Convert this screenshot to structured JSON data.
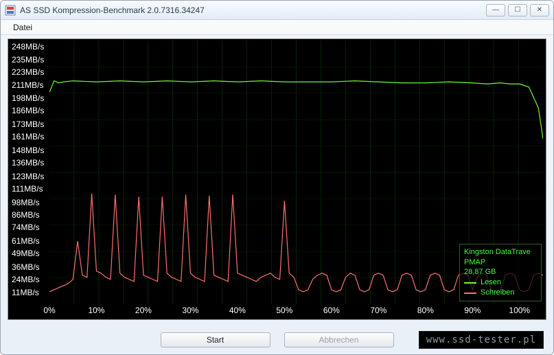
{
  "window": {
    "title": "AS SSD Kompression-Benchmark 2.0.7316.34247",
    "min_label": "—",
    "max_label": "☐",
    "close_label": "✕"
  },
  "menu": {
    "file": "Datei"
  },
  "buttons": {
    "start": "Start",
    "cancel": "Abbrechen"
  },
  "info": {
    "device_line1": "Kingston DataTrave",
    "device_line2": "PMAP",
    "capacity": "28,87 GB",
    "legend_read": "Lesen",
    "legend_write": "Schreiben"
  },
  "watermark": "www.ssd-tester.pl",
  "chart_data": {
    "type": "line",
    "xlabel": "",
    "ylabel": "",
    "x_unit": "%",
    "y_unit": "MB/s",
    "xlim": [
      0,
      105
    ],
    "ylim": [
      0,
      255
    ],
    "x_ticks": [
      0,
      10,
      20,
      30,
      40,
      50,
      60,
      70,
      80,
      90,
      100
    ],
    "y_ticks": [
      11,
      24,
      36,
      49,
      61,
      74,
      86,
      98,
      111,
      123,
      136,
      148,
      161,
      173,
      186,
      198,
      211,
      223,
      235,
      248
    ],
    "y_tick_labels": [
      "11MB/s",
      "24MB/s",
      "36MB/s",
      "49MB/s",
      "61MB/s",
      "74MB/s",
      "86MB/s",
      "98MB/s",
      "111MB/s",
      "123MB/s",
      "136MB/s",
      "148MB/s",
      "161MB/s",
      "173MB/s",
      "186MB/s",
      "198MB/s",
      "211MB/s",
      "223MB/s",
      "235MB/s",
      "248MB/s"
    ],
    "series": [
      {
        "name": "Lesen",
        "color": "#6cff2e",
        "x": [
          0,
          1,
          2,
          3,
          5,
          10,
          15,
          20,
          25,
          30,
          35,
          40,
          45,
          50,
          55,
          60,
          65,
          70,
          75,
          80,
          85,
          90,
          93,
          96,
          98,
          100,
          102,
          104,
          105
        ],
        "y": [
          205,
          216,
          214,
          215,
          216,
          215,
          216,
          215,
          216,
          215,
          216,
          215,
          216,
          215,
          215,
          215,
          216,
          215,
          214,
          214,
          215,
          214,
          213,
          214,
          213,
          213,
          210,
          190,
          160
        ]
      },
      {
        "name": "Schreiben",
        "color": "#ff7070",
        "x": [
          0,
          1,
          2,
          3,
          4,
          5,
          6,
          7,
          8,
          9,
          10,
          11,
          12,
          13,
          14,
          15,
          16,
          17,
          18,
          19,
          20,
          21,
          22,
          23,
          24,
          25,
          26,
          27,
          28,
          29,
          30,
          31,
          32,
          33,
          34,
          35,
          36,
          37,
          38,
          39,
          40,
          41,
          42,
          43,
          44,
          45,
          46,
          47,
          48,
          49,
          50,
          51,
          52,
          53,
          54,
          55,
          56,
          57,
          58,
          59,
          60,
          61,
          62,
          63,
          64,
          65,
          66,
          67,
          68,
          69,
          70,
          71,
          72,
          73,
          74,
          75,
          76,
          77,
          78,
          79,
          80,
          81,
          82,
          83,
          84,
          85,
          86,
          87,
          88,
          89,
          90,
          91,
          92,
          93,
          94,
          95,
          96,
          97,
          98,
          99,
          100,
          101,
          102,
          103,
          104,
          105
        ],
        "y": [
          12,
          14,
          16,
          18,
          20,
          24,
          61,
          28,
          26,
          107,
          32,
          30,
          26,
          24,
          106,
          30,
          26,
          24,
          22,
          104,
          28,
          26,
          24,
          22,
          104,
          30,
          26,
          24,
          22,
          106,
          30,
          26,
          24,
          22,
          105,
          28,
          26,
          24,
          22,
          106,
          30,
          28,
          26,
          24,
          22,
          26,
          28,
          30,
          26,
          24,
          100,
          30,
          26,
          14,
          12,
          14,
          24,
          28,
          30,
          28,
          14,
          12,
          14,
          26,
          30,
          28,
          14,
          12,
          14,
          28,
          30,
          28,
          14,
          12,
          14,
          28,
          30,
          28,
          14,
          12,
          14,
          28,
          30,
          28,
          14,
          12,
          14,
          28,
          30,
          28,
          14,
          26,
          30,
          28,
          14,
          12,
          14,
          28,
          30,
          28,
          14,
          12,
          14,
          28,
          30,
          28
        ]
      }
    ]
  }
}
